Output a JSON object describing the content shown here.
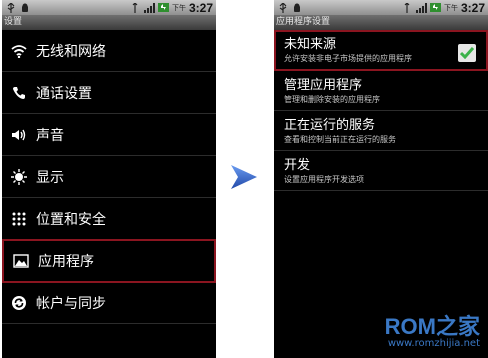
{
  "status": {
    "ampm": "下午",
    "time": "3:27"
  },
  "left": {
    "title": "设置",
    "items": [
      {
        "label": "无线和网络",
        "icon": "wifi-icon"
      },
      {
        "label": "通话设置",
        "icon": "phone-icon"
      },
      {
        "label": "声音",
        "icon": "speaker-icon"
      },
      {
        "label": "显示",
        "icon": "brightness-icon"
      },
      {
        "label": "位置和安全",
        "icon": "grid-dots-icon"
      },
      {
        "label": "应用程序",
        "icon": "picture-icon",
        "selected": true
      },
      {
        "label": "帐户与同步",
        "icon": "sync-icon"
      }
    ]
  },
  "right": {
    "title": "应用程序设置",
    "items": [
      {
        "title": "未知来源",
        "subtitle": "允许安装非电子市场提供的应用程序",
        "checked": true,
        "selected": true
      },
      {
        "title": "管理应用程序",
        "subtitle": "管理和删除安装的应用程序"
      },
      {
        "title": "正在运行的服务",
        "subtitle": "查看和控制当前正在运行的服务"
      },
      {
        "title": "开发",
        "subtitle": "设置应用程序开发选项"
      }
    ]
  },
  "watermark": {
    "logo": "ROM之家",
    "url": "www.romzhijia.net"
  },
  "colors": {
    "highlight": "#8b1520",
    "arrow": "#3b6fd0",
    "check": "#3bb24a"
  }
}
